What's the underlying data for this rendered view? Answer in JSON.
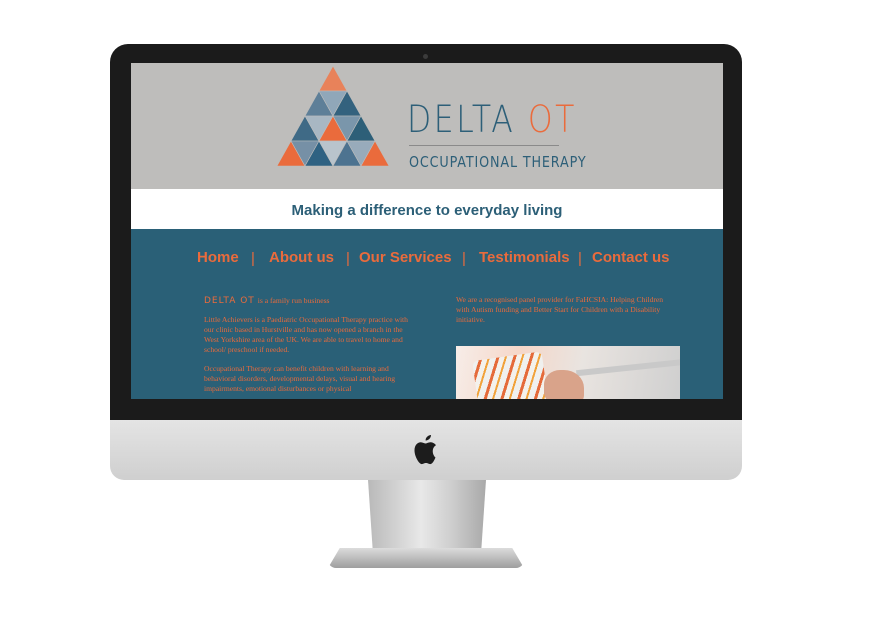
{
  "site": {
    "brand": {
      "name_main": "DELTA",
      "name_accent": "OT",
      "subtitle": "OCCUPATIONAL THERAPY"
    },
    "tagline": "Making a difference to everyday living",
    "nav": {
      "items": [
        "Home",
        "About us",
        "Our Services",
        "Testimonials",
        "Contact us"
      ],
      "separator": "|"
    },
    "intro": {
      "brand_inline": "DELTA OT",
      "text": "is a family run business"
    },
    "left_paragraphs": [
      "Little Achievers is a Paediatric Occupational Therapy practice with our clinic based in Hurstville and has now opened a branch in the West Yorkshire area of the UK. We are able to travel to home and school/ preschool if needed.",
      "Occupational Therapy can benefit children with learning and behavioral disorders, developmental delays, visual and hearing impairments, emotional disturbances or physical"
    ],
    "right_paragraph": "We are a recognised panel provider for FaHCSIA: Helping Children with Autism funding and Better Start for Children with a Disability initiative.",
    "colors": {
      "header_bg": "#bebdbb",
      "accent": "#ea6b3c",
      "primary": "#2a6077",
      "text_blue": "#2d5f78"
    }
  },
  "device": {
    "logo": "apple-logo-icon"
  }
}
